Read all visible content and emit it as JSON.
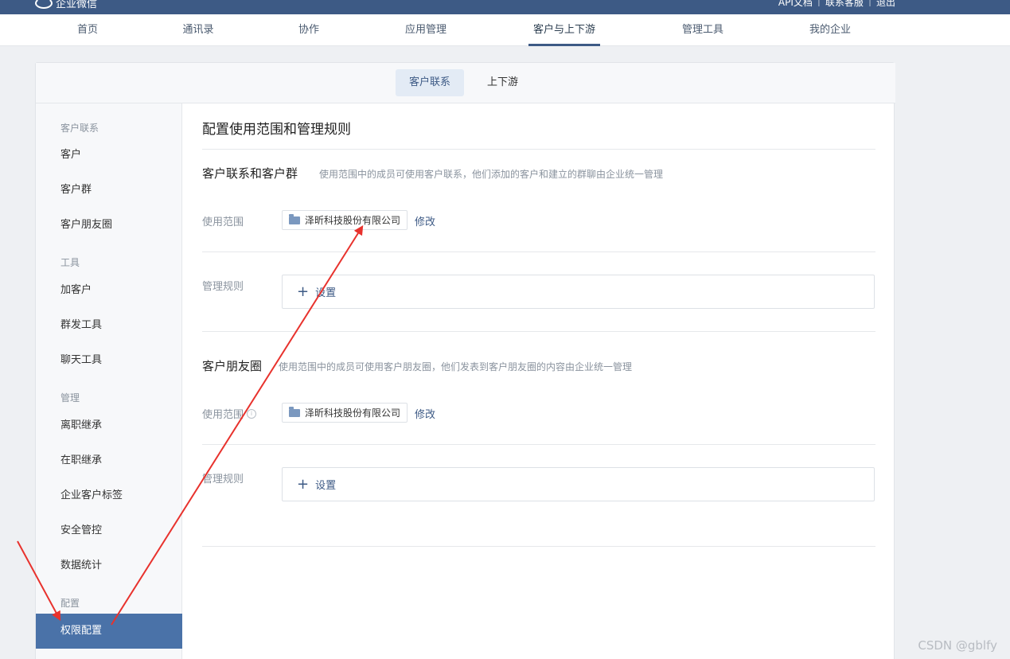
{
  "header": {
    "brand": "企业微信",
    "links": [
      "API文档",
      "联系客服",
      "退出"
    ]
  },
  "nav": {
    "items": [
      "首页",
      "通讯录",
      "协作",
      "应用管理",
      "客户与上下游",
      "管理工具",
      "我的企业"
    ],
    "active": "客户与上下游"
  },
  "subtabs": {
    "items": [
      "客户联系",
      "上下游"
    ],
    "active": "客户联系"
  },
  "sidebar": {
    "groups": [
      "客户联系",
      "工具",
      "管理",
      "配置"
    ],
    "items": [
      "客户",
      "客户群",
      "客户朋友圈",
      "加客户",
      "群发工具",
      "聊天工具",
      "离职继承",
      "在职继承",
      "企业客户标签",
      "安全管控",
      "数据统计",
      "权限配置"
    ],
    "active": "权限配置"
  },
  "main": {
    "title": "配置使用范围和管理规则",
    "section1": {
      "title": "客户联系和客户群",
      "desc": "使用范围中的成员可使用客户联系，他们添加的客户和建立的群聊由企业统一管理",
      "scope_label": "使用范围",
      "scope_value": "泽昕科技股份有限公司",
      "edit_label": "修改",
      "rule_label": "管理规则",
      "set_label": "设置"
    },
    "section2": {
      "title": "客户朋友圈",
      "desc": "使用范围中的成员可使用客户朋友圈，他们发表到客户朋友圈的内容由企业统一管理",
      "scope_label": "使用范围",
      "scope_value": "泽昕科技股份有限公司",
      "edit_label": "修改",
      "rule_label": "管理规则",
      "set_label": "设置"
    }
  },
  "icons": {
    "folder": "folder-icon",
    "plus": "plus-icon",
    "info": "info-icon"
  },
  "colors": {
    "header": "#3d5a85",
    "active_side": "#4a72a8",
    "arrow": "#e8322d"
  },
  "watermark": "CSDN @gblfy"
}
